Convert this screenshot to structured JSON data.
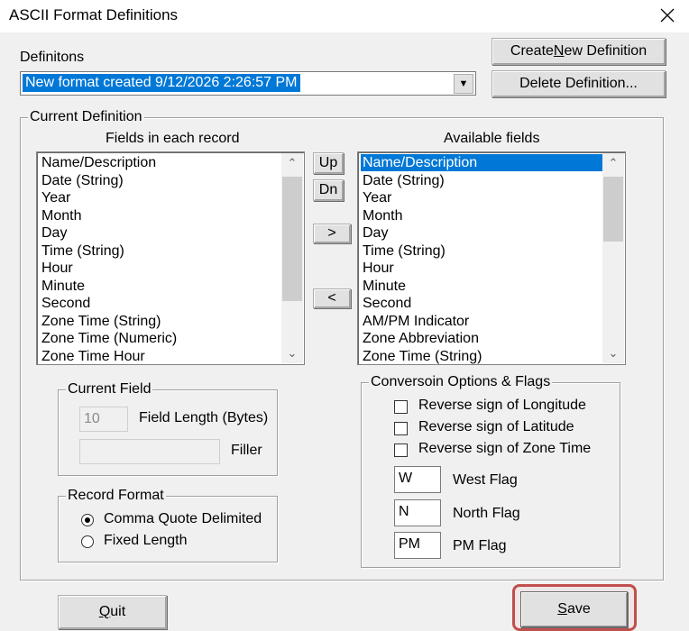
{
  "window": {
    "title": "ASCII Format Definitions"
  },
  "definitions": {
    "label": "Definitons",
    "selected": "New format created 9/12/2026 2:26:57 PM",
    "create_button": {
      "pre": "Create ",
      "accel": "N",
      "post": "ew Definition"
    },
    "delete_button": "Delete Definition..."
  },
  "current_definition": {
    "label": "Current Definition",
    "fields_header": "Fields in each record",
    "available_header": "Available fields",
    "fields": [
      "Name/Description",
      "Date (String)",
      "Year",
      "Month",
      "Day",
      "Time (String)",
      "Hour",
      "Minute",
      "Second",
      "Zone Time (String)",
      "Zone Time (Numeric)",
      "Zone Time Hour"
    ],
    "available": [
      "Name/Description",
      "Date (String)",
      "Year",
      "Month",
      "Day",
      "Time (String)",
      "Hour",
      "Minute",
      "Second",
      "AM/PM Indicator",
      "Zone Abbreviation",
      "Zone Time (String)"
    ],
    "up_button": "Up",
    "down_button": "Dn",
    "add_button": ">",
    "remove_button": "<"
  },
  "current_field": {
    "label": "Current Field",
    "length_value": "10",
    "length_label": "Field Length (Bytes)",
    "filler_value": "",
    "filler_label": "Filler"
  },
  "record_format": {
    "label": "Record Format",
    "options": [
      "Comma Quote Delimited",
      "Fixed Length"
    ],
    "selected_index": 0
  },
  "conversion": {
    "label": "Conversoin Options & Flags",
    "checks": [
      "Reverse sign of Longitude",
      "Reverse sign of Latitude",
      "Reverse sign of Zone Time"
    ],
    "west_value": "W",
    "west_label": "West Flag",
    "north_value": "N",
    "north_label": "North Flag",
    "pm_value": "PM",
    "pm_label": "PM Flag"
  },
  "buttons": {
    "quit": {
      "accel": "Q",
      "post": "uit"
    },
    "save": {
      "accel": "S",
      "post": "ave"
    }
  },
  "colors": {
    "selection": "#0078d7",
    "save_highlight": "#c0504d"
  }
}
